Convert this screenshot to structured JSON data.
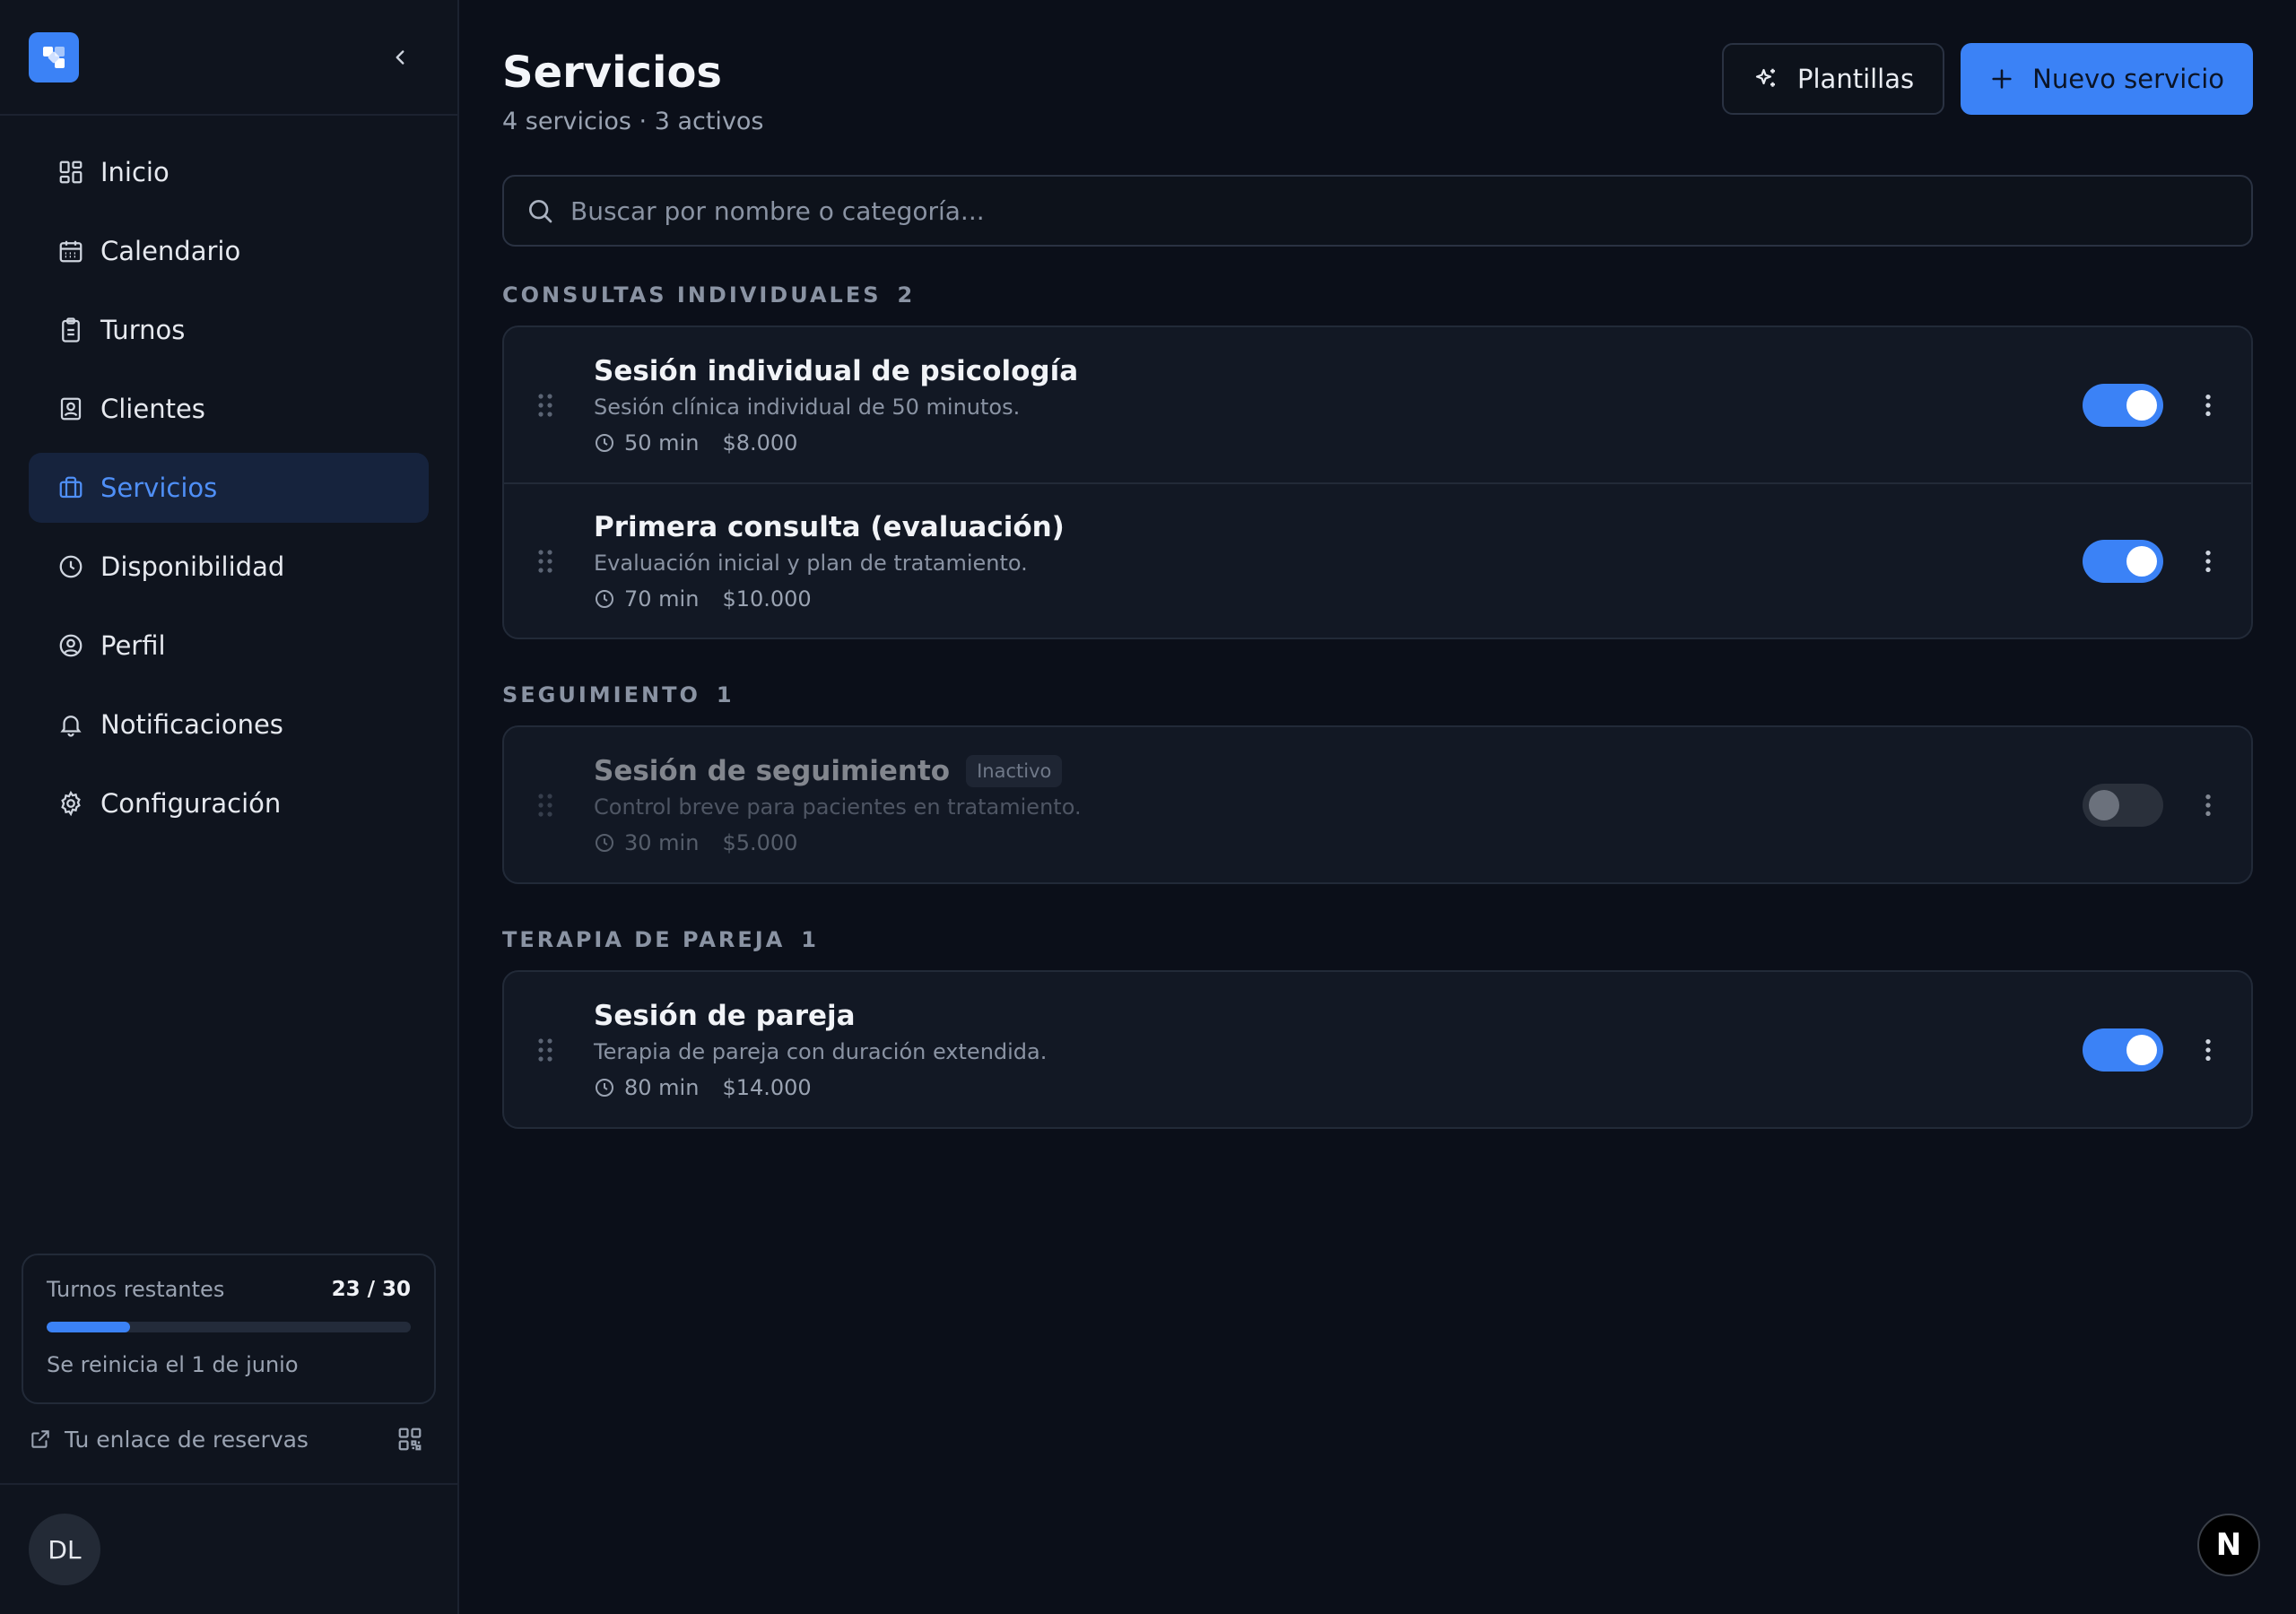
{
  "sidebar": {
    "logo_icon": "logo-icon",
    "collapse_icon": "chevron-left-icon",
    "items": [
      {
        "label": "Inicio",
        "icon": "grid-icon"
      },
      {
        "label": "Calendario",
        "icon": "calendar-icon"
      },
      {
        "label": "Turnos",
        "icon": "clipboard-icon"
      },
      {
        "label": "Clientes",
        "icon": "contact-icon"
      },
      {
        "label": "Servicios",
        "icon": "briefcase-icon",
        "active": true
      },
      {
        "label": "Disponibilidad",
        "icon": "clock-icon"
      },
      {
        "label": "Perfil",
        "icon": "user-circle-icon"
      },
      {
        "label": "Notificaciones",
        "icon": "bell-icon"
      },
      {
        "label": "Configuración",
        "icon": "gear-icon"
      }
    ],
    "quota": {
      "label": "Turnos restantes",
      "value": "23 / 30",
      "fill_fraction": 0.23,
      "reset": "Se reinicia el 1 de junio"
    },
    "booking_link": "Tu enlace de reservas",
    "avatar_initials": "DL"
  },
  "header": {
    "title": "Servicios",
    "subtitle": "4 servicios · 3 activos",
    "templates_label": "Plantillas",
    "new_label": "Nuevo servicio"
  },
  "search": {
    "placeholder": "Buscar por nombre o categoría..."
  },
  "groups": [
    {
      "title": "CONSULTAS INDIVIDUALES",
      "count": "2",
      "services": [
        {
          "name": "Sesión individual de psicología",
          "description": "Sesión clínica individual de 50 minutos.",
          "duration": "50 min",
          "price": "$8.000",
          "active": true
        },
        {
          "name": "Primera consulta (evaluación)",
          "description": "Evaluación inicial y plan de tratamiento.",
          "duration": "70 min",
          "price": "$10.000",
          "active": true
        }
      ]
    },
    {
      "title": "SEGUIMIENTO",
      "count": "1",
      "services": [
        {
          "name": "Sesión de seguimiento",
          "badge": "Inactivo",
          "description": "Control breve para pacientes en tratamiento.",
          "duration": "30 min",
          "price": "$5.000",
          "active": false
        }
      ]
    },
    {
      "title": "TERAPIA DE PAREJA",
      "count": "1",
      "services": [
        {
          "name": "Sesión de pareja",
          "description": "Terapia de pareja con duración extendida.",
          "duration": "80 min",
          "price": "$14.000",
          "active": true
        }
      ]
    }
  ],
  "fab_label": "N",
  "colors": {
    "accent": "#3b82f6",
    "background": "#0b0f19",
    "sidebar": "#0f141e",
    "card": "#121824"
  }
}
